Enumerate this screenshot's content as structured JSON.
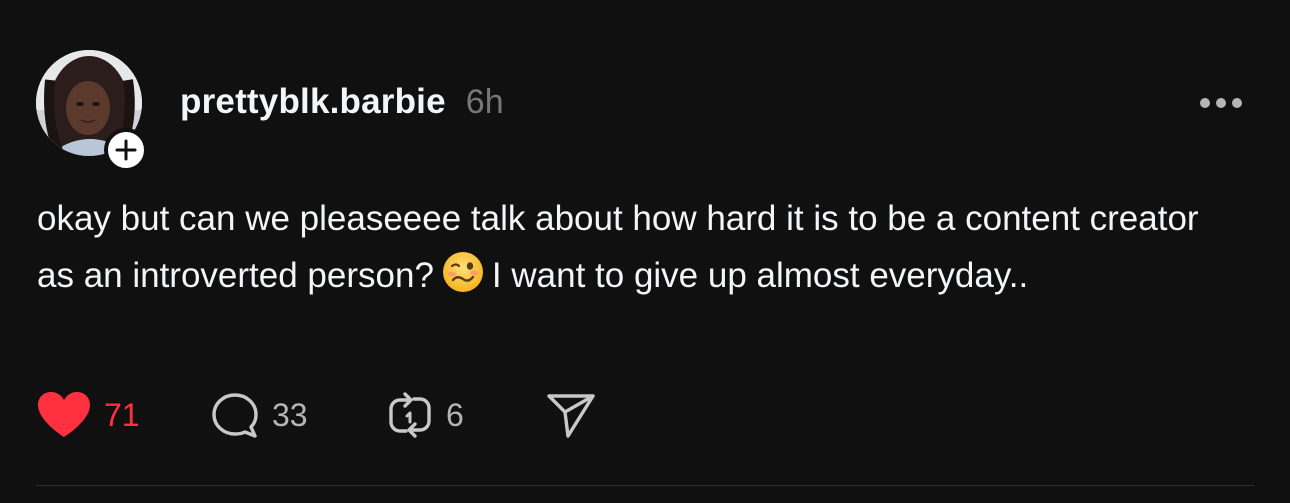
{
  "post": {
    "username": "prettyblk.barbie",
    "timestamp": "6h",
    "text_before_emoji": "okay but can we pleaseeee talk about how hard it is to be a content creator as an introverted person?",
    "emoji": "woozy-face",
    "text_after_emoji": "I want to give up almost everyday.."
  },
  "actions": {
    "likes": "71",
    "replies": "33",
    "reposts": "6"
  },
  "icons": {
    "avatar_badge": "plus-icon",
    "more": "more-dots-icon",
    "like": "heart-icon",
    "reply": "comment-icon",
    "repost": "repost-icon",
    "share": "send-icon"
  },
  "colors": {
    "background": "#101010",
    "text": "#f3f5f7",
    "muted": "#777777",
    "like_active": "#ff3040"
  }
}
